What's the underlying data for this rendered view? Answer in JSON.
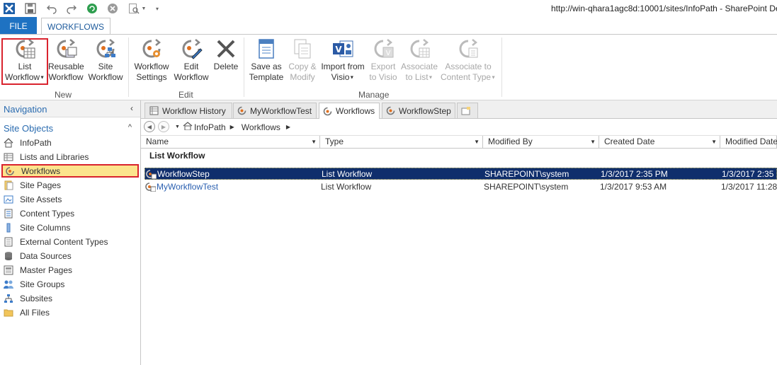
{
  "window": {
    "url_title": "http://win-qhara1agc8d:10001/sites/InfoPath - SharePoint De"
  },
  "tabs": {
    "file": "FILE",
    "workflows": "WORKFLOWS"
  },
  "ribbon": {
    "groups": {
      "new": "New",
      "edit": "Edit",
      "manage": "Manage"
    },
    "buttons": {
      "list_workflow": [
        "List",
        "Workflow"
      ],
      "reusable_workflow": [
        "Reusable",
        "Workflow"
      ],
      "site_workflow": [
        "Site",
        "Workflow"
      ],
      "workflow_settings": [
        "Workflow",
        "Settings"
      ],
      "edit_workflow": [
        "Edit",
        "Workflow"
      ],
      "delete": [
        "Delete"
      ],
      "save_as_template": [
        "Save as",
        "Template"
      ],
      "copy_modify": [
        "Copy &",
        "Modify"
      ],
      "import_from_visio": [
        "Import from",
        "Visio"
      ],
      "export_to_visio": [
        "Export",
        "to Visio"
      ],
      "associate_to_list": [
        "Associate",
        "to List"
      ],
      "associate_to_content_type": [
        "Associate to",
        "Content Type"
      ]
    }
  },
  "navigation": {
    "title": "Navigation",
    "collapse_glyph": "‹",
    "site_objects_title": "Site Objects",
    "toggle_glyph": "^",
    "items": [
      {
        "label": "InfoPath",
        "icon": "home-icon"
      },
      {
        "label": "Lists and Libraries",
        "icon": "list-icon"
      },
      {
        "label": "Workflows",
        "icon": "workflow-icon",
        "active": true
      },
      {
        "label": "Site Pages",
        "icon": "pages-icon"
      },
      {
        "label": "Site Assets",
        "icon": "assets-icon"
      },
      {
        "label": "Content Types",
        "icon": "content-types-icon"
      },
      {
        "label": "Site Columns",
        "icon": "columns-icon"
      },
      {
        "label": "External Content Types",
        "icon": "external-content-icon"
      },
      {
        "label": "Data Sources",
        "icon": "database-icon"
      },
      {
        "label": "Master Pages",
        "icon": "master-pages-icon"
      },
      {
        "label": "Site Groups",
        "icon": "groups-icon"
      },
      {
        "label": "Subsites",
        "icon": "subsites-icon"
      },
      {
        "label": "All Files",
        "icon": "folder-icon"
      }
    ]
  },
  "doc_tabs": [
    {
      "label": "Workflow History",
      "icon": "list-icon"
    },
    {
      "label": "MyWorkflowTest",
      "icon": "workflow-icon"
    },
    {
      "label": "Workflows",
      "icon": "workflow-icon",
      "active": true
    },
    {
      "label": "WorkflowStep",
      "icon": "workflow-icon"
    },
    {
      "label": "",
      "icon": "new-tab-icon"
    }
  ],
  "breadcrumb": [
    "InfoPath",
    "Workflows"
  ],
  "grid": {
    "columns": [
      "Name",
      "Type",
      "Modified By",
      "Created Date",
      "Modified Date"
    ],
    "group_label": "List Workflow",
    "rows": [
      {
        "name": "WorkflowStep",
        "type": "List Workflow",
        "modified_by": "SHAREPOINT\\system",
        "created": "1/3/2017 2:35 PM",
        "modified": "1/3/2017 2:35",
        "selected": true
      },
      {
        "name": "MyWorkflowTest",
        "type": "List Workflow",
        "modified_by": "SHAREPOINT\\system",
        "created": "1/3/2017 9:53 AM",
        "modified": "1/3/2017 11:28"
      }
    ]
  },
  "colors": {
    "file_tab": "#1e72c2",
    "selection": "#0f2e6c",
    "highlight_border": "#d9232e",
    "active_nav": "#fce48d"
  }
}
